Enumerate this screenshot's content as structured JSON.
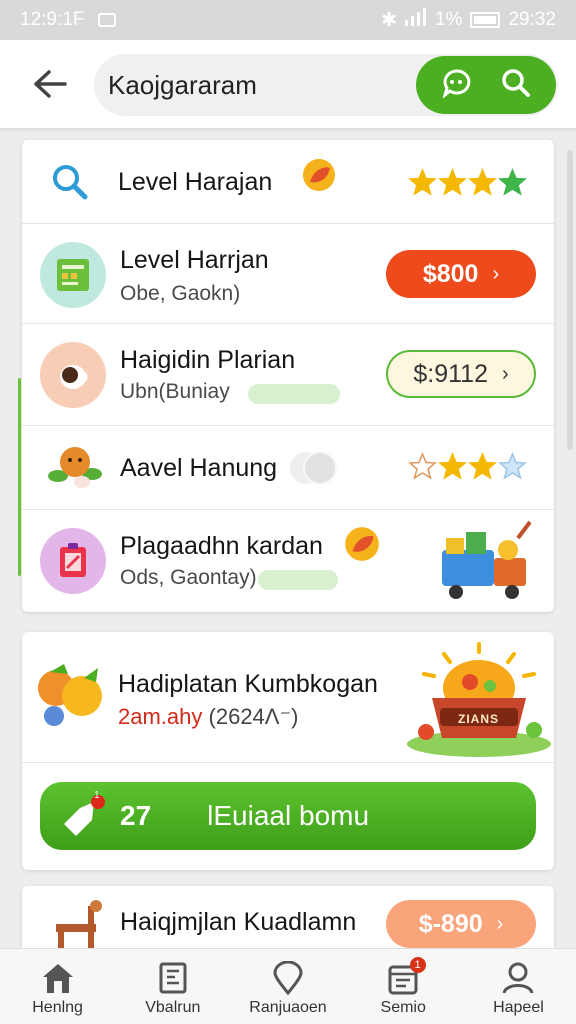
{
  "status_bar": {
    "time": "12:9:1F",
    "battery": "1%",
    "clock": "29:32"
  },
  "search": {
    "value": "Kaojgararam"
  },
  "list": [
    {
      "title": "Level Harajan",
      "rating": 4
    },
    {
      "title": "Level Harrjan",
      "subtitle": "Obe, Gaokn)",
      "price": "$800",
      "price_style": "solid"
    },
    {
      "title": "Haigidin Plarian",
      "subtitle": "Ubn(Buniay",
      "price": "$:9112",
      "price_style": "outline"
    },
    {
      "title": "Aavel Hanung",
      "rating": 2
    },
    {
      "title": "Plagaadhn kardan",
      "subtitle": "Ods, Gaontay)"
    }
  ],
  "promo": {
    "title": "Hadiplatan Kumbkogan",
    "subtitle": "2am.ahy",
    "subtitle_extra": "(2624Λ⁻)",
    "basket_label": "ZIANS",
    "bonus_count": "27",
    "bonus_label": "lEuiaal bomu",
    "badge_count": "1"
  },
  "partial_item": {
    "title": "Haiqjmjlan Kuadlamn",
    "price": "$-890"
  },
  "nav": [
    {
      "label": "Henlng",
      "icon": "home-icon"
    },
    {
      "label": "Vbalrun",
      "icon": "book-icon"
    },
    {
      "label": "Ranjuaoen",
      "icon": "location-icon"
    },
    {
      "label": "Semio",
      "icon": "calendar-icon",
      "badge": "1"
    },
    {
      "label": "Hapeel",
      "icon": "profile-icon"
    }
  ],
  "colors": {
    "accent": "#4caf22",
    "price_red": "#ee4a1c",
    "star": "#f5b800",
    "star_green": "#3fb54a"
  }
}
